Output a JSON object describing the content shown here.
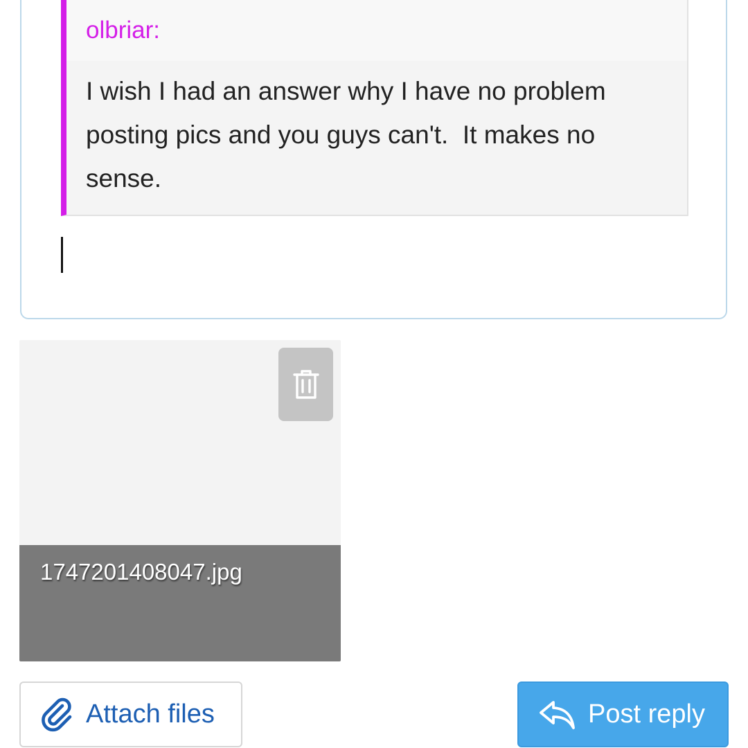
{
  "editor": {
    "quote": {
      "author": "olbriar:",
      "text": "I wish I had an answer why I have no problem\nposting pics and you guys can't.  It makes no\nsense."
    }
  },
  "attachment": {
    "filename": "1747201408047.jpg",
    "delete_icon": "trash-icon"
  },
  "actions": {
    "attach_label": "Attach files",
    "attach_icon": "paperclip-icon",
    "post_label": "Post reply",
    "post_icon": "reply-icon"
  },
  "colors": {
    "quote_accent": "#d41ee8",
    "primary_button": "#47a7ea",
    "link_blue": "#1d5fb3"
  }
}
